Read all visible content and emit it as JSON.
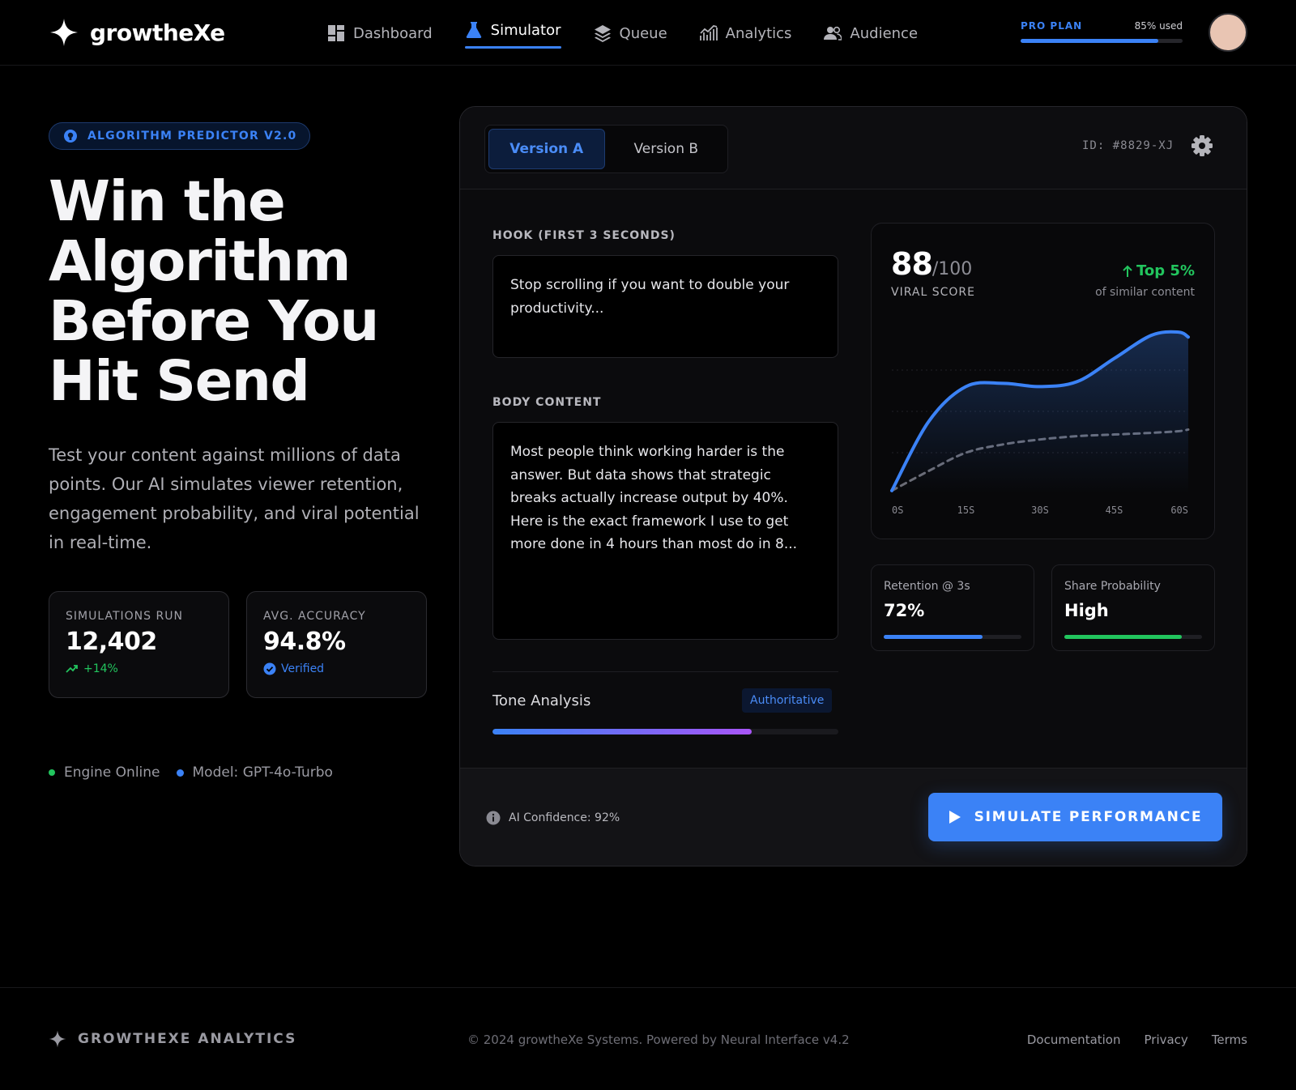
{
  "app": {
    "name": "growtheXe"
  },
  "nav": {
    "items": [
      {
        "label": "Dashboard",
        "icon": "dashboard-grid-icon"
      },
      {
        "label": "Simulator",
        "icon": "flask-icon",
        "active": true
      },
      {
        "label": "Queue",
        "icon": "layers-icon"
      },
      {
        "label": "Analytics",
        "icon": "analytics-chart-icon"
      },
      {
        "label": "Audience",
        "icon": "users-icon"
      }
    ]
  },
  "plan": {
    "label": "PRO PLAN",
    "used_text": "85% used",
    "used_fraction": 0.85
  },
  "hero": {
    "badge": "ALGORITHM PREDICTOR V2.0",
    "title_lines": [
      "Win the",
      "Algorithm",
      "Before You",
      "Hit Send"
    ],
    "subtitle": "Test your content against millions of data points. Our AI simulates viewer retention, engagement probability, and viral potential in real-time.",
    "stats": [
      {
        "label": "SIMULATIONS RUN",
        "value": "12,402",
        "sub": "+14%"
      },
      {
        "label": "AVG. ACCURACY",
        "value": "94.8%",
        "sub": "Verified"
      }
    ],
    "status": [
      {
        "label": "Engine Online",
        "color": "#22c55e"
      },
      {
        "label": "Model: GPT-4o-Turbo",
        "color": "#3b82f6"
      }
    ]
  },
  "panel": {
    "tabs": [
      "Version A",
      "Version B"
    ],
    "active_tab": "Version A",
    "id_text": "ID: #8829-XJ",
    "hook": {
      "label": "HOOK (FIRST 3 SECONDS)",
      "value": "Stop scrolling if you want to double your productivity..."
    },
    "body": {
      "label": "BODY CONTENT",
      "value": "Most people think working harder is the answer. But data shows that strategic breaks actually increase output by 40%. Here is the exact framework I use to get more done in 4 hours than most do in 8..."
    },
    "tone": {
      "label": "Tone Analysis",
      "badge": "Authoritative",
      "fraction": 0.75
    },
    "score": {
      "value": "88",
      "max": "/100",
      "label": "VIRAL SCORE",
      "rank": "Top 5%",
      "rank_sub": "of similar content"
    },
    "metrics": [
      {
        "label": "Retention @ 3s",
        "value": "72%",
        "fraction": 0.72,
        "color": "#3b82f6"
      },
      {
        "label": "Share Probability",
        "value": "High",
        "fraction": 0.85,
        "color": "#22c55e"
      }
    ],
    "confidence": "AI Confidence: 92%",
    "cta": "SIMULATE PERFORMANCE"
  },
  "chart_data": {
    "type": "line",
    "x_ticks": [
      "0S",
      "15S",
      "30S",
      "45S",
      "60S"
    ],
    "x": [
      0,
      7.5,
      15,
      22.5,
      30,
      37.5,
      45,
      52.5,
      58,
      60
    ],
    "ylim": [
      0,
      100
    ],
    "grid": true,
    "series": [
      {
        "values": [
          2,
          44,
          65,
          67,
          65,
          68,
          82,
          96,
          98,
          95
        ],
        "color": "#3b82f6",
        "style": "solid"
      },
      {
        "values": [
          2,
          14,
          25,
          30,
          33,
          35,
          36,
          37,
          38,
          39
        ],
        "color": "#6b6b73",
        "style": "dashed"
      }
    ]
  },
  "footer": {
    "brand": "GROWTHEXE ANALYTICS",
    "copyright": "© 2024 growtheXe Systems. Powered by Neural Interface v4.2",
    "links": [
      "Documentation",
      "Privacy",
      "Terms"
    ]
  }
}
